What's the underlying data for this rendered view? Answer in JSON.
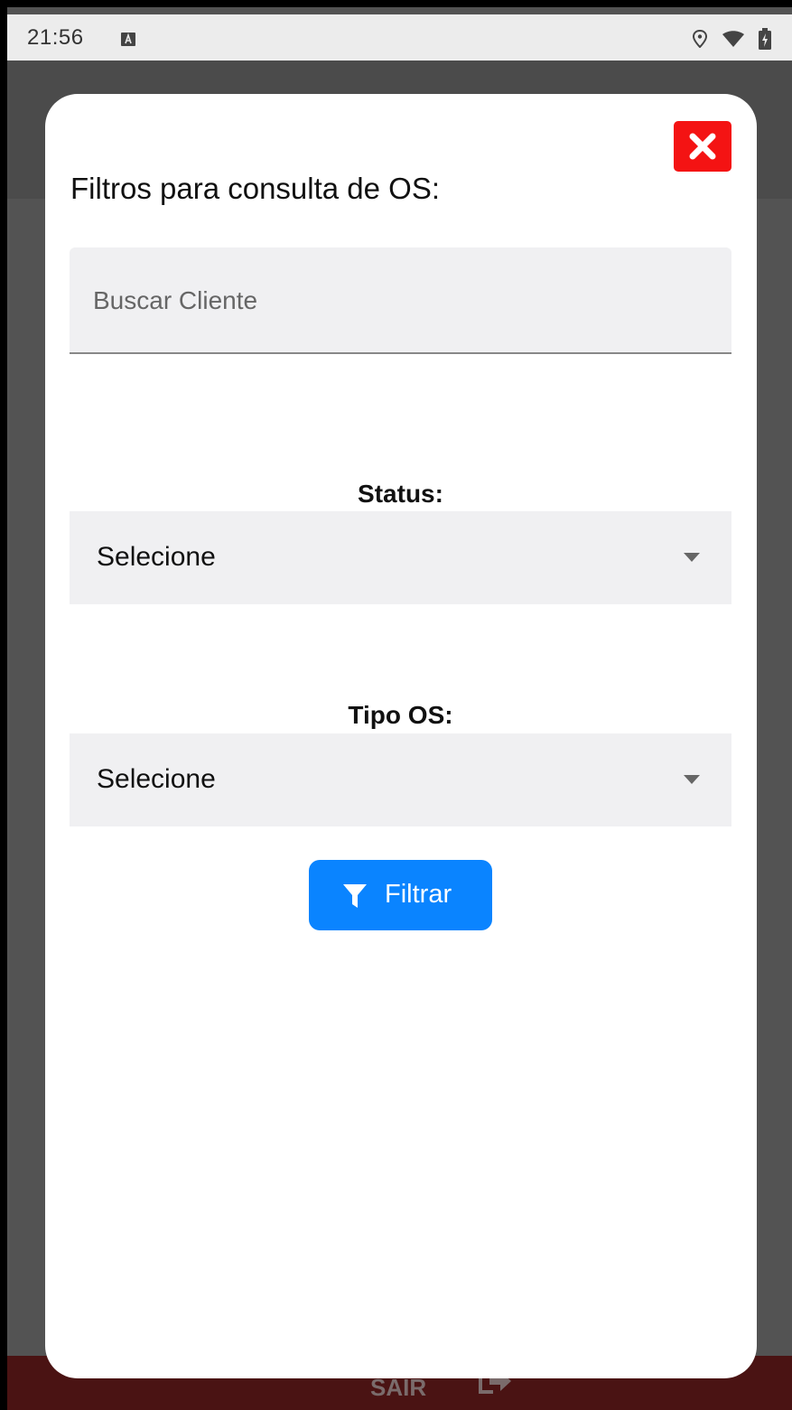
{
  "status_bar": {
    "time": "21:56",
    "icons": [
      "notification-a-icon",
      "location-icon",
      "wifi-icon",
      "battery-charging-icon"
    ]
  },
  "background_app": {
    "exit_label": "SAIR"
  },
  "modal": {
    "title": "Filtros para consulta de OS:",
    "search": {
      "placeholder": "Buscar Cliente",
      "value": ""
    },
    "status": {
      "label": "Status:",
      "selected": "Selecione"
    },
    "tipo_os": {
      "label": "Tipo OS:",
      "selected": "Selecione"
    },
    "filter_button": {
      "label": "Filtrar"
    }
  },
  "colors": {
    "close_button": "#f41313",
    "filter_button": "#0a84ff",
    "field_background": "#f0f0f2",
    "overlay": "#535353",
    "bottom_bar": "#4a1313"
  }
}
